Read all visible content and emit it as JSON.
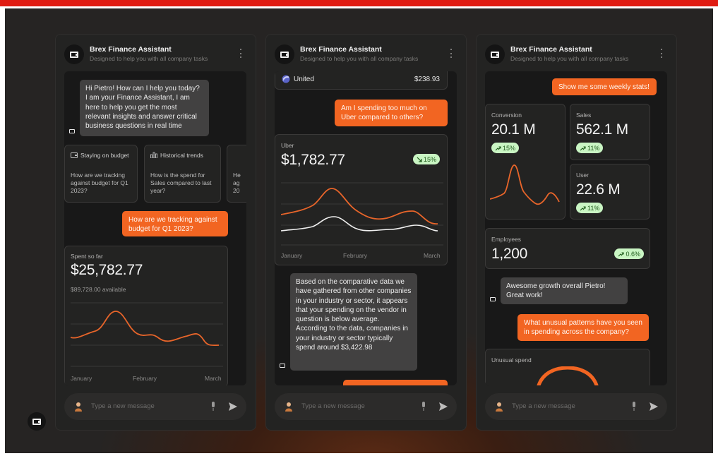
{
  "assistant": {
    "title": "Brex Finance Assistant",
    "subtitle": "Designed to help you with all company tasks",
    "composer_placeholder": "Type a new message"
  },
  "panel1": {
    "greeting": "Hi Pietro! How can I help you today? I am your Finance Assistant, I am here to help you get the most relevant insights and answer critical business questions in real time",
    "suggestions": [
      {
        "title": "Staying on budget",
        "body": "How are we tracking against budget for Q1 2023?"
      },
      {
        "title": "Historical trends",
        "body": "How is the spend for Sales compared to last year?"
      },
      {
        "title": "",
        "body": "He ag 20"
      }
    ],
    "user_message": "How are we tracking against budget for Q1 2023?",
    "spend_card": {
      "label": "Spent so far",
      "amount": "$25,782.77",
      "available": "$89,728.00 available",
      "axis": [
        "January",
        "February",
        "March"
      ]
    }
  },
  "panel2": {
    "vendor_row": {
      "name": "United",
      "amount": "$238.93"
    },
    "user_message": "Am I spending too much on Uber compared to others?",
    "uber_card": {
      "label": "Uber",
      "amount": "$1,782.77",
      "badge": "15%",
      "axis": [
        "January",
        "February",
        "March"
      ]
    },
    "answer": "Based on the comparative data we have gathered from other companies in your industry or sector, it appears that your spending on the vendor in question is below average. According to the data, companies in your industry or sector typically spend around $3,422.98"
  },
  "panel3": {
    "user_message": "Show me some weekly stats!",
    "conversion": {
      "label": "Conversion",
      "value": "20.1 M",
      "badge": "15%"
    },
    "sales": {
      "label": "Sales",
      "value": "562.1 M",
      "badge": "11%"
    },
    "user": {
      "label": "User",
      "value": "22.6 M",
      "badge": "11%"
    },
    "employees": {
      "label": "Employees",
      "value": "1,200",
      "badge": "0.6%"
    },
    "assistant_reply": "Awesome growth overall Pietro! Great work!",
    "user_message_2": "What unusual patterns have you seen in spending across the company?",
    "unusual_card": {
      "label": "Unusual spend"
    }
  },
  "colors": {
    "accent": "#f26522",
    "badge_bg": "#c9f5c3",
    "top_bar": "#e01b12"
  }
}
